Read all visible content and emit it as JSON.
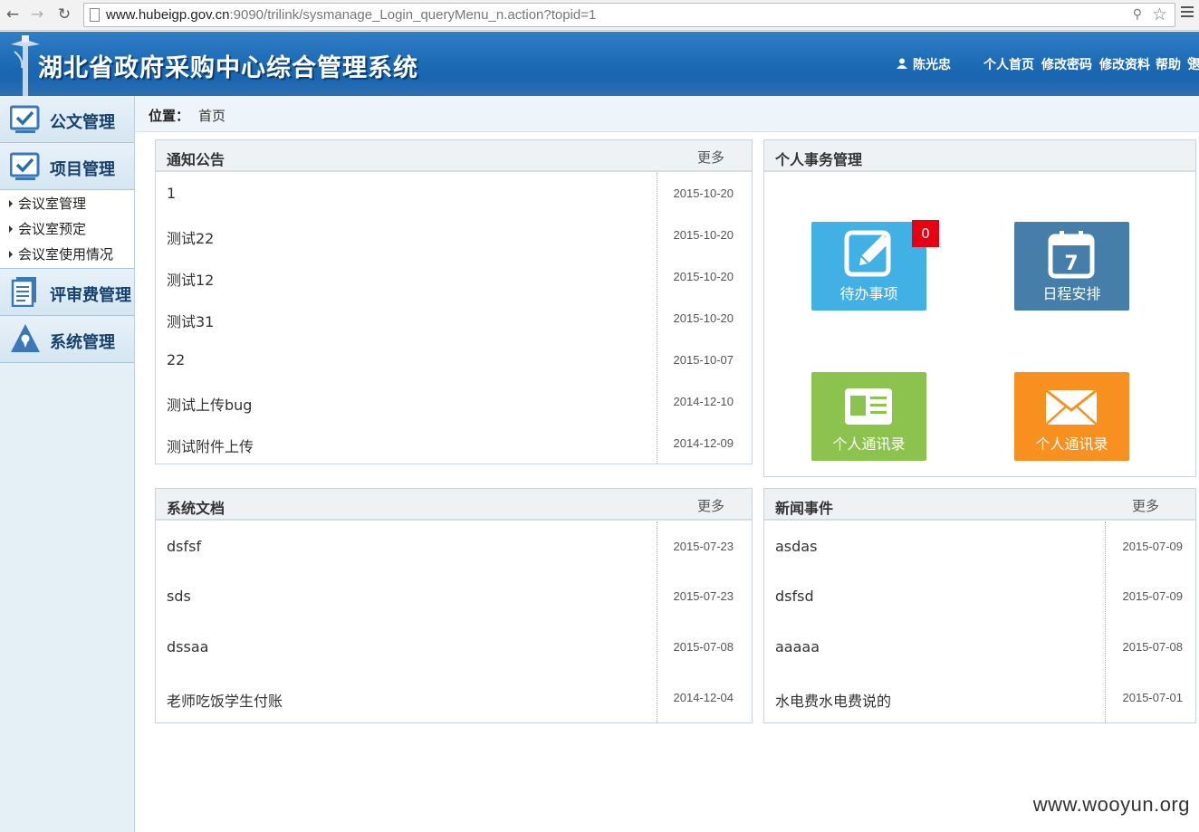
{
  "browser": {
    "url_host": "www.hubeigp.gov.cn",
    "url_rest": ":9090/trilink/sysmanage_Login_queryMenu_n.action?topid=1"
  },
  "header": {
    "system_title": "湖北省政府采购中心综合管理系统",
    "user_name": "陈光忠",
    "links": {
      "home": "个人首页",
      "change_password": "修改密码",
      "edit_profile": "修改资料",
      "logout": "退出",
      "help": "帮助"
    }
  },
  "sidebar": {
    "sections": [
      {
        "label": "公文管理",
        "icon": "checkbox-icon"
      },
      {
        "label": "项目管理",
        "icon": "checkbox-icon"
      },
      {
        "label": "评审费管理",
        "icon": "document-icon"
      },
      {
        "label": "系统管理",
        "icon": "warning-icon"
      }
    ],
    "sub_items": [
      "会议室管理",
      "会议室预定",
      "会议室使用情况"
    ]
  },
  "breadcrumb": {
    "label": "位置：",
    "value": "首页"
  },
  "notices": {
    "title": "通知公告",
    "more": "更多",
    "rows": [
      {
        "title": "1",
        "date": "2015-10-20"
      },
      {
        "title": "测试22",
        "date": "2015-10-20"
      },
      {
        "title": "测试12",
        "date": "2015-10-20"
      },
      {
        "title": "测试31",
        "date": "2015-10-20"
      },
      {
        "title": "22",
        "date": "2015-10-07"
      },
      {
        "title": "测试上传bug",
        "date": "2014-12-10"
      },
      {
        "title": "测试附件上传",
        "date": "2014-12-09"
      }
    ]
  },
  "personal": {
    "title": "个人事务管理",
    "tiles": [
      {
        "label": "待办事项",
        "color": "#41b0e4",
        "badge": "0"
      },
      {
        "label": "日程安排",
        "color": "#457ea8",
        "calendar_day": "7"
      },
      {
        "label": "个人通讯录",
        "color": "#8cc34f"
      },
      {
        "label": "个人通讯录",
        "color": "#f7901e"
      }
    ]
  },
  "sysdocs": {
    "title": "系统文档",
    "more": "更多",
    "rows": [
      {
        "title": "dsfsf",
        "date": "2015-07-23"
      },
      {
        "title": "sds",
        "date": "2015-07-23"
      },
      {
        "title": "dssaa",
        "date": "2015-07-08"
      },
      {
        "title": "老师吃饭学生付账",
        "date": "2014-12-04"
      }
    ]
  },
  "news": {
    "title": "新闻事件",
    "more": "更多",
    "rows": [
      {
        "title": "asdas",
        "date": "2015-07-09"
      },
      {
        "title": "dsfsd",
        "date": "2015-07-09"
      },
      {
        "title": "aaaaa",
        "date": "2015-07-08"
      },
      {
        "title": "水电费水电费说的",
        "date": "2015-07-01"
      }
    ]
  },
  "watermark": "www.wooyun.org"
}
